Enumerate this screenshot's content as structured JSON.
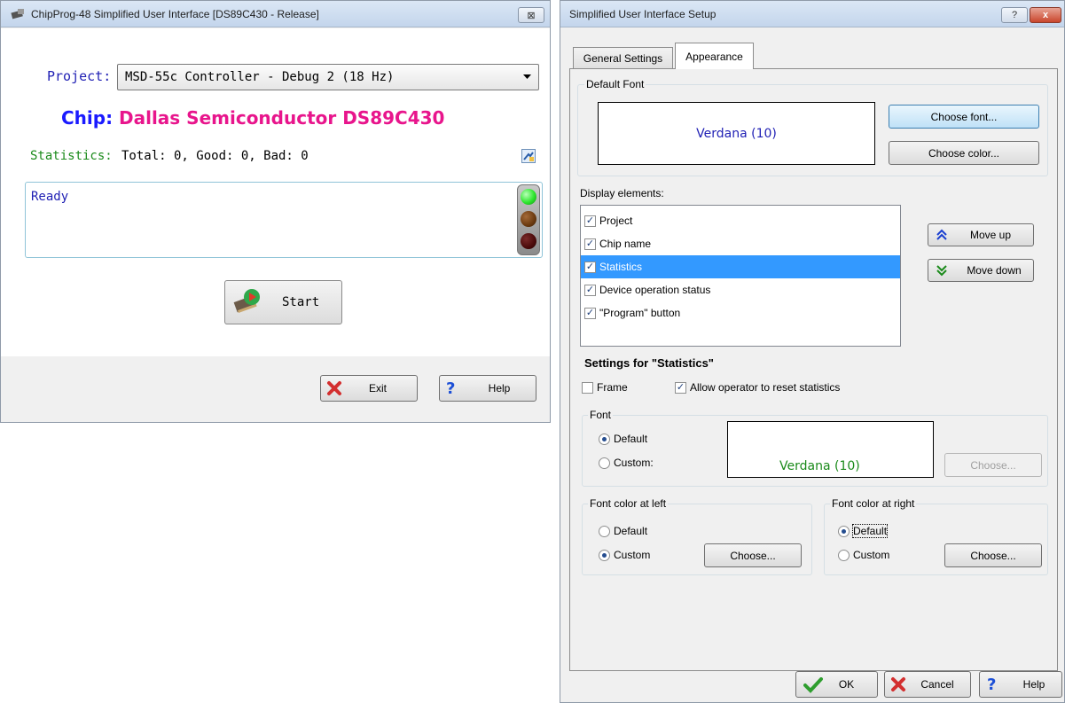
{
  "left_window": {
    "title": "ChipProg-48 Simplified User Interface [DS89C430 - Release]",
    "close_glyph": "⊠",
    "project_label": "Project:",
    "project_value": "MSD-55c Controller - Debug 2 (18 Hz)",
    "chip_label": "Chip:",
    "chip_value": "Dallas Semiconductor DS89C430",
    "statistics_label": "Statistics:",
    "statistics_value": "Total: 0, Good: 0, Bad: 0",
    "status_text": "Ready",
    "start_label": "Start",
    "exit_label": "Exit",
    "help_label": "Help",
    "colors": {
      "project_label": "#1f1fb4",
      "chip_label": "#1a1aff",
      "chip_value": "#e8158c",
      "statistics_label": "#1a8a1a",
      "status_text": "#1f1fb4",
      "light_green": "#2ee62e",
      "light_yellow": "#6b3a10",
      "light_red": "#4a0a0a"
    }
  },
  "right_window": {
    "title": "Simplified User Interface Setup",
    "help_glyph": "?",
    "close_glyph": "x",
    "tabs": [
      {
        "label": "General Settings",
        "active": false
      },
      {
        "label": "Appearance",
        "active": true
      }
    ],
    "default_font_group": "Default Font",
    "default_font_preview": "Verdana (10)",
    "choose_font_label": "Choose font...",
    "choose_color_label": "Choose color...",
    "display_elements_label": "Display elements:",
    "display_elements": [
      {
        "label": "Project",
        "checked": true,
        "selected": false
      },
      {
        "label": "Chip name",
        "checked": true,
        "selected": false
      },
      {
        "label": "Statistics",
        "checked": true,
        "selected": true
      },
      {
        "label": "Device operation status",
        "checked": true,
        "selected": false
      },
      {
        "label": "\"Program\" button",
        "checked": true,
        "selected": false
      }
    ],
    "move_up_label": "Move up",
    "move_down_label": "Move down",
    "settings_heading": "Settings for \"Statistics\"",
    "frame_label": "Frame",
    "frame_checked": false,
    "allow_reset_label": "Allow operator to reset statistics",
    "allow_reset_checked": true,
    "font_group": "Font",
    "font_default_label": "Default",
    "font_custom_label": "Custom:",
    "font_selected": "default",
    "font_preview": "Verdana (10)",
    "font_choose_label": "Choose...",
    "left_color_group": "Font color at left",
    "left_default_label": "Default",
    "left_custom_label": "Custom",
    "left_selected": "custom",
    "left_choose_label": "Choose...",
    "right_color_group": "Font color at right",
    "right_default_label": "Default",
    "right_custom_label": "Custom",
    "right_selected": "default",
    "right_choose_label": "Choose...",
    "ok_label": "OK",
    "cancel_label": "Cancel",
    "help_label": "Help",
    "colors": {
      "preview_text_default": "#1f1fb4",
      "preview_text_stats": "#1a8a1a",
      "selection": "#3399ff",
      "arrow_icon": "#1a3fd0"
    }
  }
}
